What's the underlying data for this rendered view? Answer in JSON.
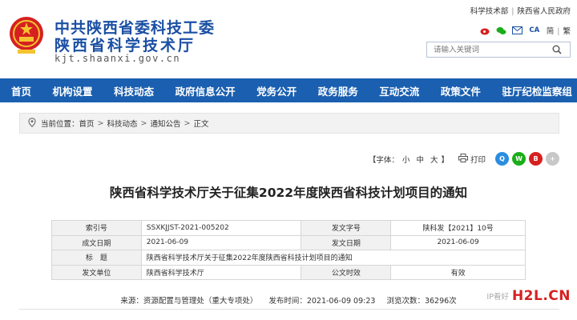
{
  "header": {
    "org_line1": "中共陕西省委科技工委",
    "org_line2": "陕西省科学技术厅",
    "domain": "kjt.shaanxi.gov.cn",
    "top_links": [
      "科学技术部",
      "陕西省人民政府"
    ],
    "lang_simplified": "简",
    "lang_traditional": "繁",
    "ca_label": "CA",
    "search_placeholder": "请输入关键词"
  },
  "nav": {
    "items": [
      "首页",
      "机构设置",
      "科技动态",
      "政府信息公开",
      "党务公开",
      "政务服务",
      "互动交流",
      "政策文件",
      "驻厅纪检监察组"
    ]
  },
  "breadcrumb": {
    "prefix": "当前位置：",
    "items": [
      "首页",
      "科技动态",
      "通知公告",
      "正文"
    ],
    "sep": ">"
  },
  "tools": {
    "font_label": "【字体：",
    "font_small": "小",
    "font_medium": "中",
    "font_large": "大",
    "font_close": "】",
    "print": "打印"
  },
  "article": {
    "title": "陕西省科学技术厅关于征集2022年度陕西省科技计划项目的通知"
  },
  "info": {
    "index_label": "索引号",
    "index_value": "SSXKJJST-2021-005202",
    "docno_label": "发文字号",
    "docno_value": "陕科发【2021】10号",
    "created_label": "成文日期",
    "created_value": "2021-06-09",
    "published_label": "发文日期",
    "published_value": "2021-06-09",
    "subject_label": "标　题",
    "subject_value": "陕西省科学技术厅关于征集2022年度陕西省科技计划项目的通知",
    "issuer_label": "发文单位",
    "issuer_value": "陕西省科学技术厅",
    "validity_label": "公文时效",
    "validity_value": "有效"
  },
  "source": {
    "from": "来源：资源配置与管理处（重大专项处）",
    "time": "发布时间：2021-06-09 09:23",
    "views": "浏览次数：36296次"
  },
  "watermark": {
    "brand_h": "H2L",
    "brand_cn": ".CN",
    "read_label": "IP看好"
  },
  "colors": {
    "brand_blue": "#1a5fb0",
    "title_blue": "#1a4fa3",
    "emblem_red": "#d62020"
  }
}
